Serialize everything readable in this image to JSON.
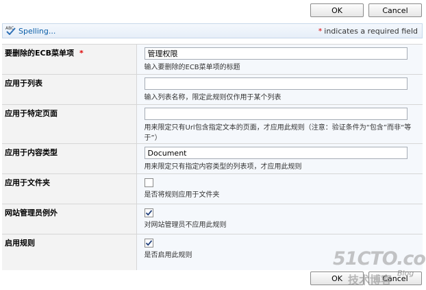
{
  "buttons": {
    "ok": "OK",
    "cancel": "Cancel"
  },
  "toolbar": {
    "spelling": "Spelling...",
    "required_star": "*",
    "required_note": "indicates a required field"
  },
  "fields": [
    {
      "label": "要删除的ECB菜单项",
      "required_star": "*",
      "type": "text",
      "value": "管理权限",
      "description": "输入要删除的ECB菜单项的标题"
    },
    {
      "label": "应用于列表",
      "type": "text",
      "value": "",
      "description": "输入列表名称，限定此规则仅作用于某个列表"
    },
    {
      "label": "应用于特定页面",
      "type": "text",
      "value": "",
      "description": "用来限定只有Url包含指定文本的页面，才应用此规则（注意：验证条件为“包含”而非“等于”）"
    },
    {
      "label": "应用于内容类型",
      "type": "text",
      "value": "Document",
      "description": "用来限定只有指定内容类型的列表项，才应用此规则"
    },
    {
      "label": "应用于文件夹",
      "type": "checkbox",
      "checked": false,
      "description": "是否将规则应用于文件夹"
    },
    {
      "label": "网站管理员例外",
      "type": "checkbox",
      "checked": true,
      "description": "对网站管理员不应用此规则"
    },
    {
      "label": "启用规则",
      "type": "checkbox",
      "checked": true,
      "description": "是否启用此规则"
    }
  ],
  "watermark": {
    "main": "51CTO.com",
    "sub": "技术博客",
    "blog": "Blog"
  },
  "colors": {
    "required": "#dd0000",
    "link": "#0a5ea8",
    "label_bg": "#f3f3f3",
    "control_bg": "#f5f8fc"
  }
}
